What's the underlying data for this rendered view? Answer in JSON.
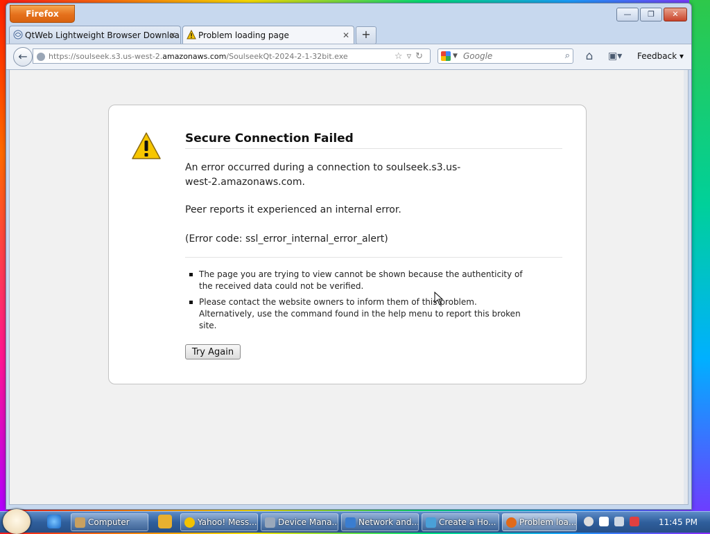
{
  "window": {
    "app_button": "Firefox",
    "controls": {
      "minimize": "—",
      "maximize": "❐",
      "close": "✕"
    }
  },
  "tabs": [
    {
      "title": "QtWeb Lightweight Browser Downloa...",
      "close": "✕"
    },
    {
      "title": "Problem loading page",
      "close": "✕"
    }
  ],
  "new_tab_label": "+",
  "navbar": {
    "back_label": "←",
    "url_prefix": "https://soulseek.s3.us-west-2.",
    "url_domain": "amazonaws.com",
    "url_path": "/SoulseekQt-2024-2-1-32bit.exe",
    "url_icons": "☆▿↻",
    "search_placeholder": "Google",
    "search_icon": "⌕",
    "home_icon": "⌂",
    "bookmarks_icon": "▣▾",
    "feedback_label": "Feedback ▾"
  },
  "error_page": {
    "title": "Secure Connection Failed",
    "message": "An error occurred during a connection to soulseek.s3.us-west-2.amazonaws.com.",
    "detail": "Peer reports it experienced an internal error.",
    "code": "(Error code: ssl_error_internal_error_alert)",
    "bullets": [
      "The page you are trying to view cannot be shown because the authenticity of the received data could not be verified.",
      "Please contact the website owners to inform them of this problem. Alternatively, use the command found in the help menu to report this broken site."
    ],
    "button": "Try Again"
  },
  "taskbar": {
    "items": [
      {
        "label": "Computer",
        "icon_color": "#c8a060"
      },
      {
        "label": "Yahoo! Mess...",
        "icon_color": "#f2c200"
      },
      {
        "label": "Device Mana...",
        "icon_color": "#9aa8bb"
      },
      {
        "label": "Network and...",
        "icon_color": "#3a7dd0"
      },
      {
        "label": "Create a Ho...",
        "icon_color": "#4aa0d8"
      },
      {
        "label": "Problem loa...",
        "icon_color": "#e06a1a"
      }
    ],
    "clock": "11:45 PM"
  }
}
